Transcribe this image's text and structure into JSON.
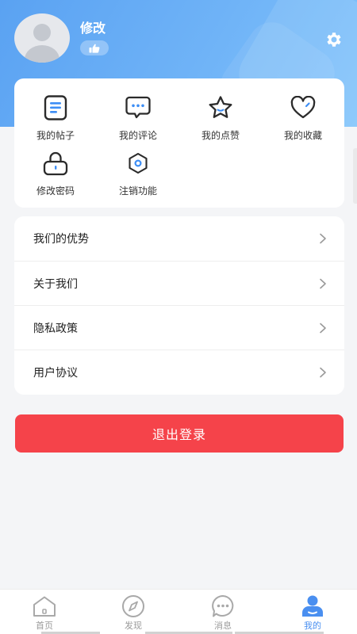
{
  "profile": {
    "name": "修改",
    "like_icon": "thumbs-up-icon",
    "settings_icon": "gear-icon"
  },
  "grid": [
    {
      "label": "我的帖子",
      "icon": "document-icon"
    },
    {
      "label": "我的评论",
      "icon": "comment-icon"
    },
    {
      "label": "我的点赞",
      "icon": "star-icon"
    },
    {
      "label": "我的收藏",
      "icon": "heart-icon"
    },
    {
      "label": "修改密码",
      "icon": "lock-icon"
    },
    {
      "label": "注销功能",
      "icon": "hexagon-icon"
    }
  ],
  "list": [
    {
      "label": "我们的优势"
    },
    {
      "label": "关于我们"
    },
    {
      "label": "隐私政策"
    },
    {
      "label": "用户协议"
    }
  ],
  "logout_label": "退出登录",
  "tabs": [
    {
      "label": "首页",
      "icon": "home-icon",
      "active": false
    },
    {
      "label": "发现",
      "icon": "compass-icon",
      "active": false
    },
    {
      "label": "消息",
      "icon": "message-icon",
      "active": false
    },
    {
      "label": "我的",
      "icon": "user-icon",
      "active": true
    }
  ],
  "colors": {
    "accent": "#4a8ff0",
    "header_gradient_start": "#5aa2f2",
    "header_gradient_end": "#82c4fb",
    "logout": "#f5434a",
    "icon_blue": "#3d8ef5",
    "icon_dark": "#2b2b2b"
  }
}
